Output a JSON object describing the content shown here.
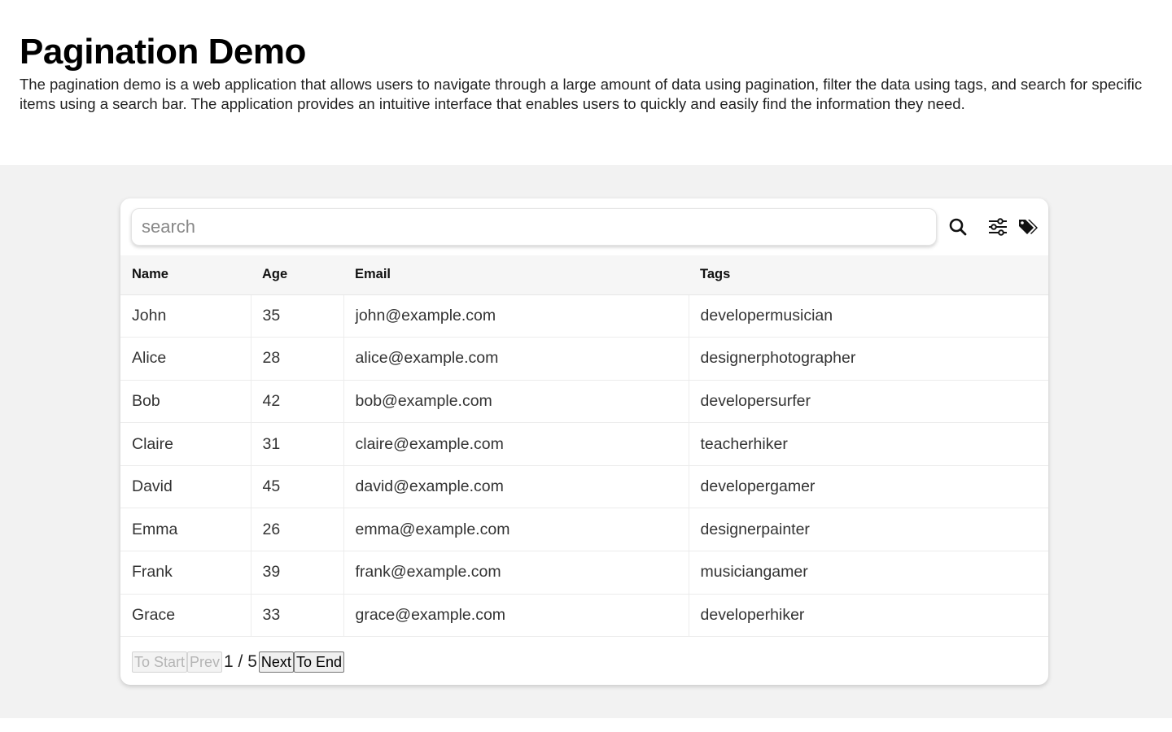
{
  "page": {
    "title": "Pagination Demo",
    "description": "The pagination demo is a web application that allows users to navigate through a large amount of data using pagination, filter the data using tags, and search for specific items using a search bar. The application provides an intuitive interface that enables users to quickly and easily find the information they need."
  },
  "search": {
    "placeholder": "search",
    "value": "",
    "search_icon": "search-icon",
    "filter_icon": "sliders-icon",
    "tags_icon": "tags-icon"
  },
  "table": {
    "columns": [
      "Name",
      "Age",
      "Email",
      "Tags"
    ],
    "rows": [
      [
        "John",
        "35",
        "john@example.com",
        "developermusician"
      ],
      [
        "Alice",
        "28",
        "alice@example.com",
        "designerphotographer"
      ],
      [
        "Bob",
        "42",
        "bob@example.com",
        "developersurfer"
      ],
      [
        "Claire",
        "31",
        "claire@example.com",
        "teacherhiker"
      ],
      [
        "David",
        "45",
        "david@example.com",
        "developergamer"
      ],
      [
        "Emma",
        "26",
        "emma@example.com",
        "designerpainter"
      ],
      [
        "Frank",
        "39",
        "frank@example.com",
        "musiciangamer"
      ],
      [
        "Grace",
        "33",
        "grace@example.com",
        "developerhiker"
      ]
    ]
  },
  "pagination": {
    "to_start_label": "To Start",
    "prev_label": "Prev",
    "indicator": "1 / 5",
    "current_page": 1,
    "total_pages": 5,
    "next_label": "Next",
    "to_end_label": "To End"
  }
}
